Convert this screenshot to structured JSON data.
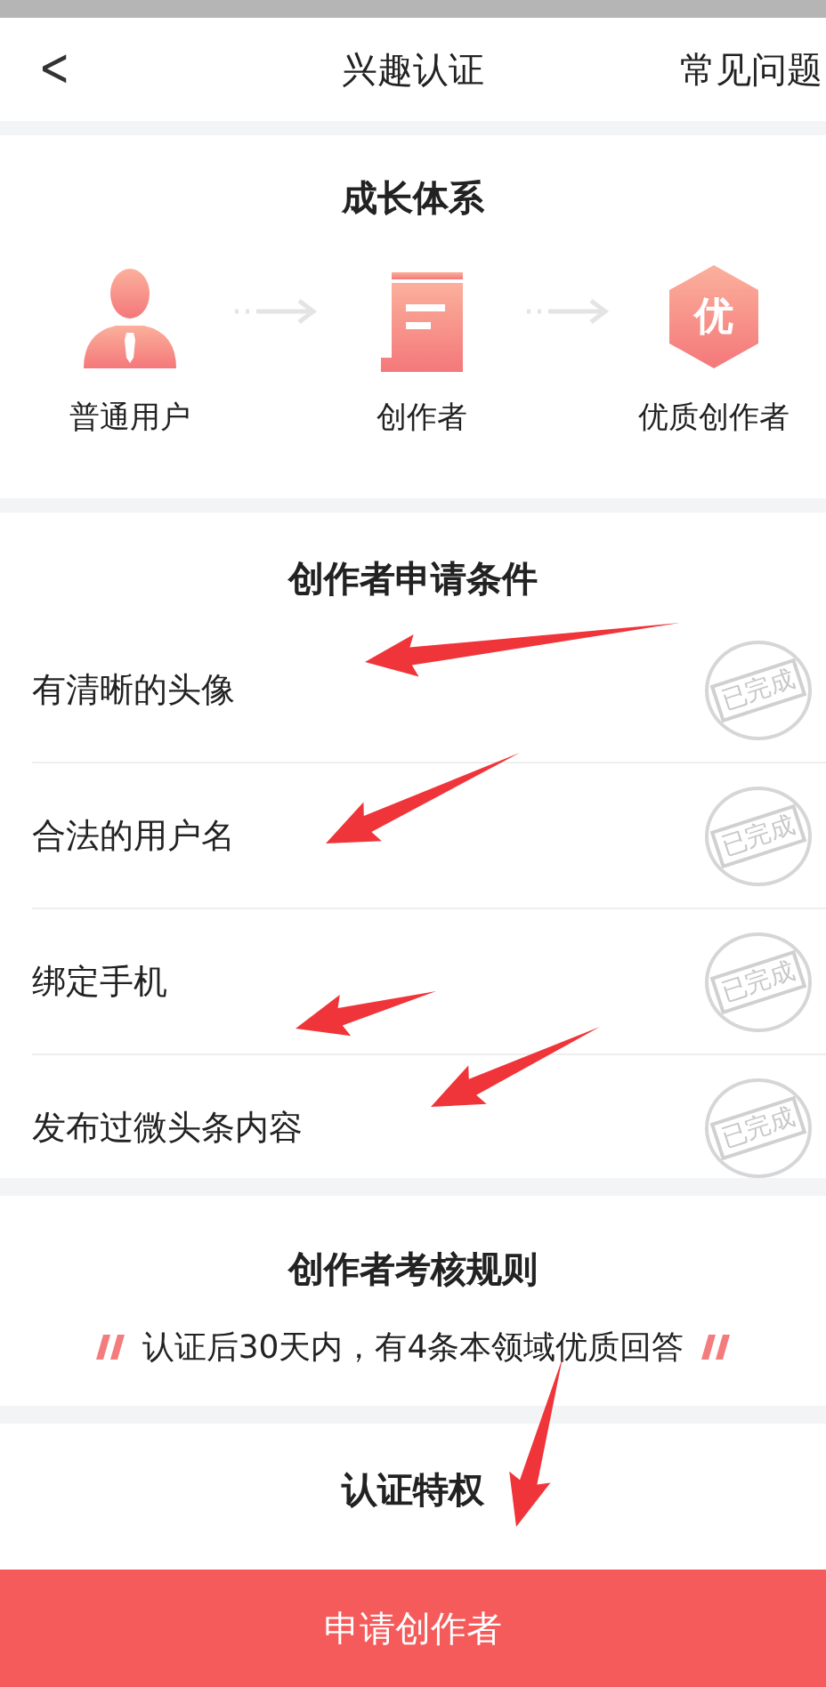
{
  "header": {
    "back": "<",
    "title": "兴趣认证",
    "action": "常见问题"
  },
  "growth": {
    "title": "成长体系",
    "stages": [
      {
        "kind": "user",
        "label": "普通用户"
      },
      {
        "kind": "document",
        "label": "创作者"
      },
      {
        "kind": "badge",
        "badge_text": "优",
        "label": "优质创作者"
      }
    ]
  },
  "conditions": {
    "title": "创作者申请条件",
    "items": [
      {
        "label": "有清晰的头像",
        "done": true,
        "stamp": "已完成"
      },
      {
        "label": "合法的用户名",
        "done": true,
        "stamp": "已完成"
      },
      {
        "label": "绑定手机",
        "done": true,
        "stamp": "已完成"
      },
      {
        "label": "发布过微头条内容",
        "done": true,
        "stamp": "已完成"
      }
    ]
  },
  "rules": {
    "title": "创作者考核规则",
    "text": "认证后30天内，有4条本领域优质回答"
  },
  "privileges": {
    "title": "认证特权"
  },
  "apply_button": "申请创作者"
}
